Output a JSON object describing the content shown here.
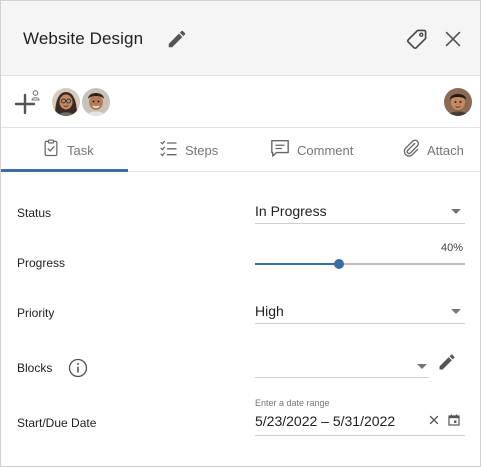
{
  "header": {
    "title": "Website Design",
    "edit_icon": "pencil-icon",
    "tag_icon": "tag-icon",
    "close_icon": "close-icon"
  },
  "assignees": {
    "add_icon": "add-person-icon",
    "people": [
      "avatar-woman",
      "avatar-man",
      "avatar-owner"
    ]
  },
  "tabs": [
    {
      "label": "Task",
      "icon": "clipboard-check-icon",
      "active": true
    },
    {
      "label": "Steps",
      "icon": "checklist-icon",
      "active": false
    },
    {
      "label": "Comment",
      "icon": "comment-icon",
      "active": false
    },
    {
      "label": "Attach",
      "icon": "paperclip-icon",
      "active": false
    }
  ],
  "form": {
    "status": {
      "label": "Status",
      "value": "In Progress"
    },
    "progress": {
      "label": "Progress",
      "value": 40,
      "value_text": "40%"
    },
    "priority": {
      "label": "Priority",
      "value": "High"
    },
    "blocks": {
      "label": "Blocks",
      "value": ""
    },
    "dates": {
      "label": "Start/Due Date",
      "hint": "Enter a date range",
      "value": "5/23/2022 – 5/31/2022"
    }
  },
  "colors": {
    "accent": "#3a6ea5",
    "header_bg": "#f5f5f5",
    "border": "#e3e3e3",
    "muted_text": "#757575"
  }
}
